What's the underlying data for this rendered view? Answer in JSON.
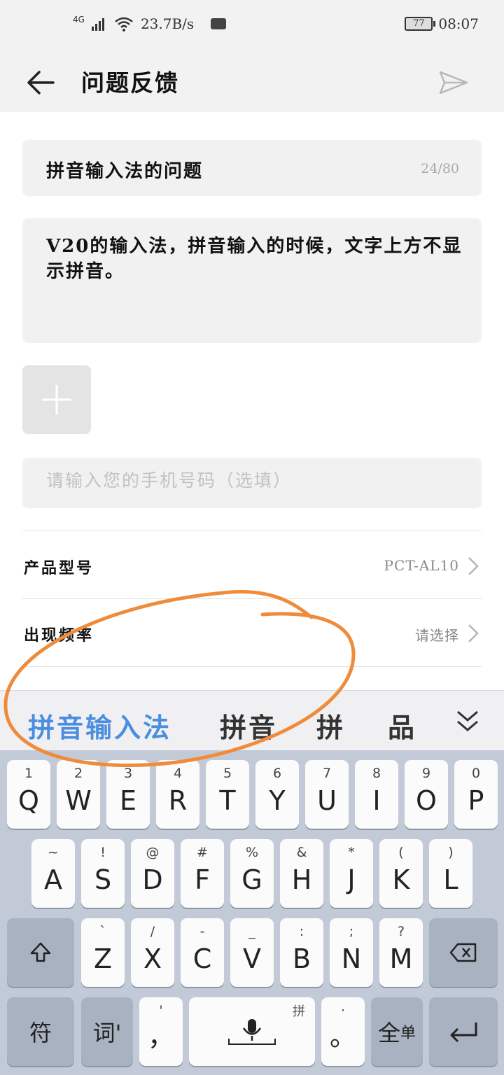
{
  "status_bar": {
    "network": "4G",
    "speed": "23.7B/s",
    "battery": "77",
    "time": "08:07"
  },
  "header": {
    "title": "问题反馈",
    "back_icon": "arrow-left-icon",
    "send_icon": "send-icon"
  },
  "form": {
    "title_value": "拼音输入法的问题",
    "title_counter": "24/80",
    "description_value": "V20的输入法，拼音输入的时候，文字上方不显示拼音。",
    "add_image_icon": "plus-icon",
    "phone_placeholder": "请输入您的手机号码（选填）",
    "rows": [
      {
        "label": "产品型号",
        "value": "PCT-AL10"
      },
      {
        "label": "出现频率",
        "value": "请选择"
      }
    ]
  },
  "ime": {
    "candidates": [
      "拼音输入法",
      "拼音",
      "拼",
      "品"
    ],
    "collapse_icon": "double-chevron-down-icon",
    "row1": [
      {
        "hint": "1",
        "label": "Q"
      },
      {
        "hint": "2",
        "label": "W"
      },
      {
        "hint": "3",
        "label": "E"
      },
      {
        "hint": "4",
        "label": "R"
      },
      {
        "hint": "5",
        "label": "T"
      },
      {
        "hint": "6",
        "label": "Y"
      },
      {
        "hint": "7",
        "label": "U"
      },
      {
        "hint": "8",
        "label": "I"
      },
      {
        "hint": "9",
        "label": "O"
      },
      {
        "hint": "0",
        "label": "P"
      }
    ],
    "row2": [
      {
        "hint": "~",
        "label": "A"
      },
      {
        "hint": "!",
        "label": "S"
      },
      {
        "hint": "@",
        "label": "D"
      },
      {
        "hint": "#",
        "label": "F"
      },
      {
        "hint": "%",
        "label": "G"
      },
      {
        "hint": "&",
        "label": "H"
      },
      {
        "hint": "*",
        "label": "J"
      },
      {
        "hint": "(",
        "label": "K"
      },
      {
        "hint": ")",
        "label": "L"
      }
    ],
    "row3": [
      {
        "hint": "`",
        "label": "Z"
      },
      {
        "hint": "/",
        "label": "X"
      },
      {
        "hint": "-",
        "label": "C"
      },
      {
        "hint": "_",
        "label": "V"
      },
      {
        "hint": ":",
        "label": "B"
      },
      {
        "hint": ";",
        "label": "N"
      },
      {
        "hint": "?",
        "label": "M"
      }
    ],
    "shift_icon": "shift-icon",
    "backspace_icon": "backspace-icon",
    "symbol_key": "符",
    "word_key": "词'",
    "comma_hint": "'",
    "comma_key": "，",
    "space_corner": "拼",
    "mic_icon": "microphone-icon",
    "period_hint": "·",
    "period_key": "。",
    "fullwidth_key_main": "全",
    "fullwidth_key_sub": "单",
    "enter_icon": "enter-icon"
  },
  "colors": {
    "accent": "#4b8ee0",
    "annotation": "#ef8c3c",
    "keyboard_bg": "#c3cad7"
  }
}
